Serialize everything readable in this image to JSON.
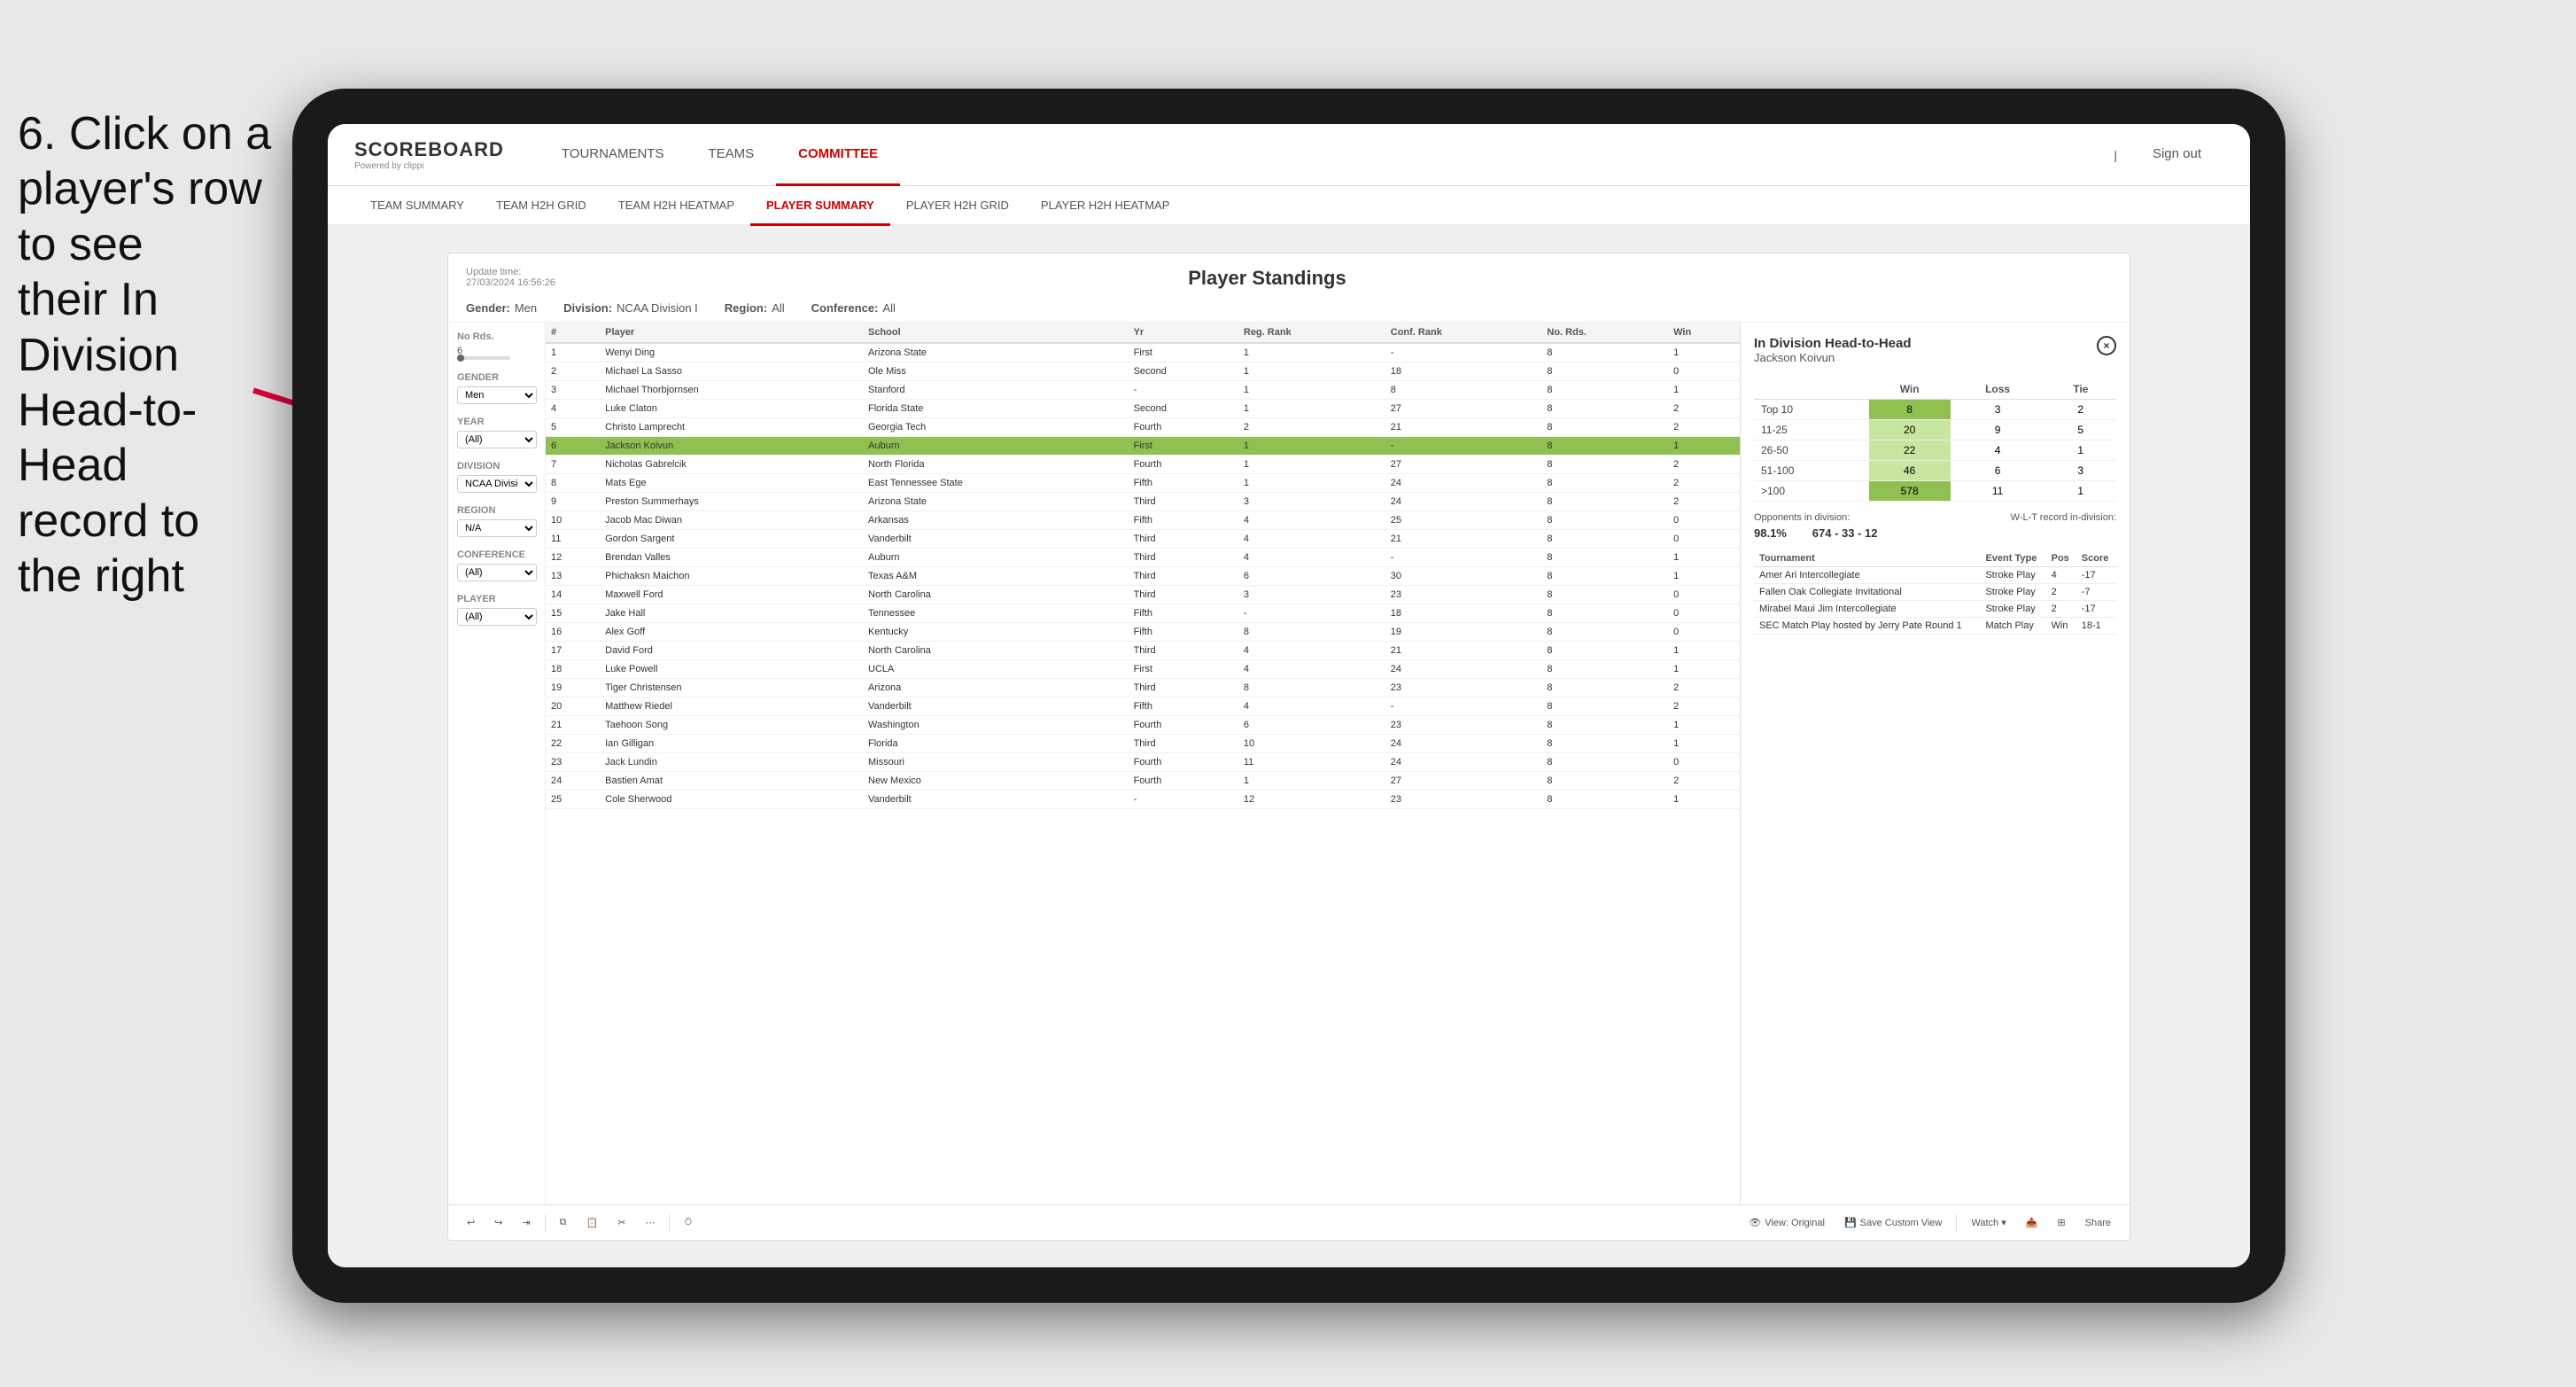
{
  "instruction": {
    "line1": "6. Click on a",
    "line2": "player's row to see",
    "line3": "their In Division",
    "line4": "Head-to-Head",
    "line5": "record to the right"
  },
  "nav": {
    "logo": "SCOREBOARD",
    "logo_sub": "Powered by clippi",
    "items": [
      "TOURNAMENTS",
      "TEAMS",
      "COMMITTEE"
    ],
    "sign_out": "Sign out"
  },
  "sub_nav": {
    "items": [
      "TEAM SUMMARY",
      "TEAM H2H GRID",
      "TEAM H2H HEATMAP",
      "PLAYER SUMMARY",
      "PLAYER H2H GRID",
      "PLAYER H2H HEATMAP"
    ],
    "active": "PLAYER SUMMARY"
  },
  "card": {
    "update_time_label": "Update time:",
    "update_time": "27/03/2024 16:56:26",
    "title": "Player Standings",
    "filters": {
      "gender_label": "Gender:",
      "gender_value": "Men",
      "division_label": "Division:",
      "division_value": "NCAA Division I",
      "region_label": "Region:",
      "region_value": "All",
      "conference_label": "Conference:",
      "conference_value": "All"
    }
  },
  "sidebar": {
    "rounds_label": "No Rds.",
    "rounds_range": "6",
    "rounds_sub": "6-",
    "gender_label": "Gender",
    "gender_value": "Men",
    "year_label": "Year",
    "year_value": "(All)",
    "division_label": "Division",
    "division_value": "NCAA Division I",
    "region_label": "Region",
    "region_value": "N/A",
    "conference_label": "Conference",
    "conference_value": "(All)",
    "player_label": "Player",
    "player_value": "(All)"
  },
  "table": {
    "headers": [
      "#",
      "Player",
      "School",
      "Yr",
      "Reg. Rank",
      "Conf. Rank",
      "No. Rds.",
      "Win"
    ],
    "rows": [
      {
        "num": "1",
        "player": "Wenyi Ding",
        "school": "Arizona State",
        "year": "First",
        "reg_rank": "1",
        "conf_rank": "-",
        "rds": "8",
        "win": "1"
      },
      {
        "num": "2",
        "player": "Michael La Sasso",
        "school": "Ole Miss",
        "year": "Second",
        "reg_rank": "1",
        "conf_rank": "18",
        "rds": "8",
        "win": "0"
      },
      {
        "num": "3",
        "player": "Michael Thorbjornsen",
        "school": "Stanford",
        "year": "-",
        "reg_rank": "1",
        "conf_rank": "8",
        "rds": "8",
        "win": "1"
      },
      {
        "num": "4",
        "player": "Luke Claton",
        "school": "Florida State",
        "year": "Second",
        "reg_rank": "1",
        "conf_rank": "27",
        "rds": "8",
        "win": "2"
      },
      {
        "num": "5",
        "player": "Christo Lamprecht",
        "school": "Georgia Tech",
        "year": "Fourth",
        "reg_rank": "2",
        "conf_rank": "21",
        "rds": "8",
        "win": "2"
      },
      {
        "num": "6",
        "player": "Jackson Koivun",
        "school": "Auburn",
        "year": "First",
        "reg_rank": "1",
        "conf_rank": "-",
        "rds": "8",
        "win": "1",
        "selected": true
      },
      {
        "num": "7",
        "player": "Nicholas Gabrelcik",
        "school": "North Florida",
        "year": "Fourth",
        "reg_rank": "1",
        "conf_rank": "27",
        "rds": "8",
        "win": "2"
      },
      {
        "num": "8",
        "player": "Mats Ege",
        "school": "East Tennessee State",
        "year": "Fifth",
        "reg_rank": "1",
        "conf_rank": "24",
        "rds": "8",
        "win": "2"
      },
      {
        "num": "9",
        "player": "Preston Summerhays",
        "school": "Arizona State",
        "year": "Third",
        "reg_rank": "3",
        "conf_rank": "24",
        "rds": "8",
        "win": "2"
      },
      {
        "num": "10",
        "player": "Jacob Mac Diwan",
        "school": "Arkansas",
        "year": "Fifth",
        "reg_rank": "4",
        "conf_rank": "25",
        "rds": "8",
        "win": "0"
      },
      {
        "num": "11",
        "player": "Gordon Sargent",
        "school": "Vanderbilt",
        "year": "Third",
        "reg_rank": "4",
        "conf_rank": "21",
        "rds": "8",
        "win": "0"
      },
      {
        "num": "12",
        "player": "Brendan Valles",
        "school": "Auburn",
        "year": "Third",
        "reg_rank": "4",
        "conf_rank": "-",
        "rds": "8",
        "win": "1"
      },
      {
        "num": "13",
        "player": "Phichaksn Maichon",
        "school": "Texas A&M",
        "year": "Third",
        "reg_rank": "6",
        "conf_rank": "30",
        "rds": "8",
        "win": "1"
      },
      {
        "num": "14",
        "player": "Maxwell Ford",
        "school": "North Carolina",
        "year": "Third",
        "reg_rank": "3",
        "conf_rank": "23",
        "rds": "8",
        "win": "0"
      },
      {
        "num": "15",
        "player": "Jake Hall",
        "school": "Tennessee",
        "year": "Fifth",
        "reg_rank": "-",
        "conf_rank": "18",
        "rds": "8",
        "win": "0"
      },
      {
        "num": "16",
        "player": "Alex Goff",
        "school": "Kentucky",
        "year": "Fifth",
        "reg_rank": "8",
        "conf_rank": "19",
        "rds": "8",
        "win": "0"
      },
      {
        "num": "17",
        "player": "David Ford",
        "school": "North Carolina",
        "year": "Third",
        "reg_rank": "4",
        "conf_rank": "21",
        "rds": "8",
        "win": "1"
      },
      {
        "num": "18",
        "player": "Luke Powell",
        "school": "UCLA",
        "year": "First",
        "reg_rank": "4",
        "conf_rank": "24",
        "rds": "8",
        "win": "1"
      },
      {
        "num": "19",
        "player": "Tiger Christensen",
        "school": "Arizona",
        "year": "Third",
        "reg_rank": "8",
        "conf_rank": "23",
        "rds": "8",
        "win": "2"
      },
      {
        "num": "20",
        "player": "Matthew Riedel",
        "school": "Vanderbilt",
        "year": "Fifth",
        "reg_rank": "4",
        "conf_rank": "-",
        "rds": "8",
        "win": "2"
      },
      {
        "num": "21",
        "player": "Taehoon Song",
        "school": "Washington",
        "year": "Fourth",
        "reg_rank": "6",
        "conf_rank": "23",
        "rds": "8",
        "win": "1"
      },
      {
        "num": "22",
        "player": "Ian Gilligan",
        "school": "Florida",
        "year": "Third",
        "reg_rank": "10",
        "conf_rank": "24",
        "rds": "8",
        "win": "1"
      },
      {
        "num": "23",
        "player": "Jack Lundin",
        "school": "Missouri",
        "year": "Fourth",
        "reg_rank": "11",
        "conf_rank": "24",
        "rds": "8",
        "win": "0"
      },
      {
        "num": "24",
        "player": "Bastien Amat",
        "school": "New Mexico",
        "year": "Fourth",
        "reg_rank": "1",
        "conf_rank": "27",
        "rds": "8",
        "win": "2"
      },
      {
        "num": "25",
        "player": "Cole Sherwood",
        "school": "Vanderbilt",
        "year": "-",
        "reg_rank": "12",
        "conf_rank": "23",
        "rds": "8",
        "win": "1"
      }
    ]
  },
  "h2h_panel": {
    "title": "In Division Head-to-Head",
    "player_name": "Jackson Koivun",
    "close_btn": "×",
    "table": {
      "headers": [
        "",
        "Win",
        "Loss",
        "Tie"
      ],
      "rows": [
        {
          "label": "Top 10",
          "win": "8",
          "loss": "3",
          "tie": "2",
          "win_class": "win_cell_dark"
        },
        {
          "label": "11-25",
          "win": "20",
          "loss": "9",
          "tie": "5",
          "win_class": "win_cell"
        },
        {
          "label": "26-50",
          "win": "22",
          "loss": "4",
          "tie": "1",
          "win_class": "win_cell"
        },
        {
          "label": "51-100",
          "win": "46",
          "loss": "6",
          "tie": "3",
          "win_class": "win_cell"
        },
        {
          "label": ">100",
          "win": "578",
          "loss": "11",
          "tie": "1",
          "win_class": "win_cell_dark"
        }
      ]
    },
    "opponents_label": "Opponents in division:",
    "wlt_label": "W-L-T record in-division:",
    "opponents_pct": "98.1%",
    "wlt_record": "674 - 33 - 12",
    "tournaments": {
      "headers": [
        "Tournament",
        "Event Type",
        "Pos",
        "Score"
      ],
      "rows": [
        {
          "tournament": "Amer Ari Intercollegiate",
          "type": "Stroke Play",
          "pos": "4",
          "score": "-17"
        },
        {
          "tournament": "Fallen Oak Collegiate Invitational",
          "type": "Stroke Play",
          "pos": "2",
          "score": "-7"
        },
        {
          "tournament": "Mirabel Maui Jim Intercollegiate",
          "type": "Stroke Play",
          "pos": "2",
          "score": "-17"
        },
        {
          "tournament": "SEC Match Play hosted by Jerry Pate Round 1",
          "type": "Match Play",
          "pos": "Win",
          "score": "18-1"
        }
      ]
    }
  },
  "toolbar": {
    "view_original": "View: Original",
    "save_custom": "Save Custom View",
    "watch": "Watch ▾",
    "share": "Share"
  }
}
